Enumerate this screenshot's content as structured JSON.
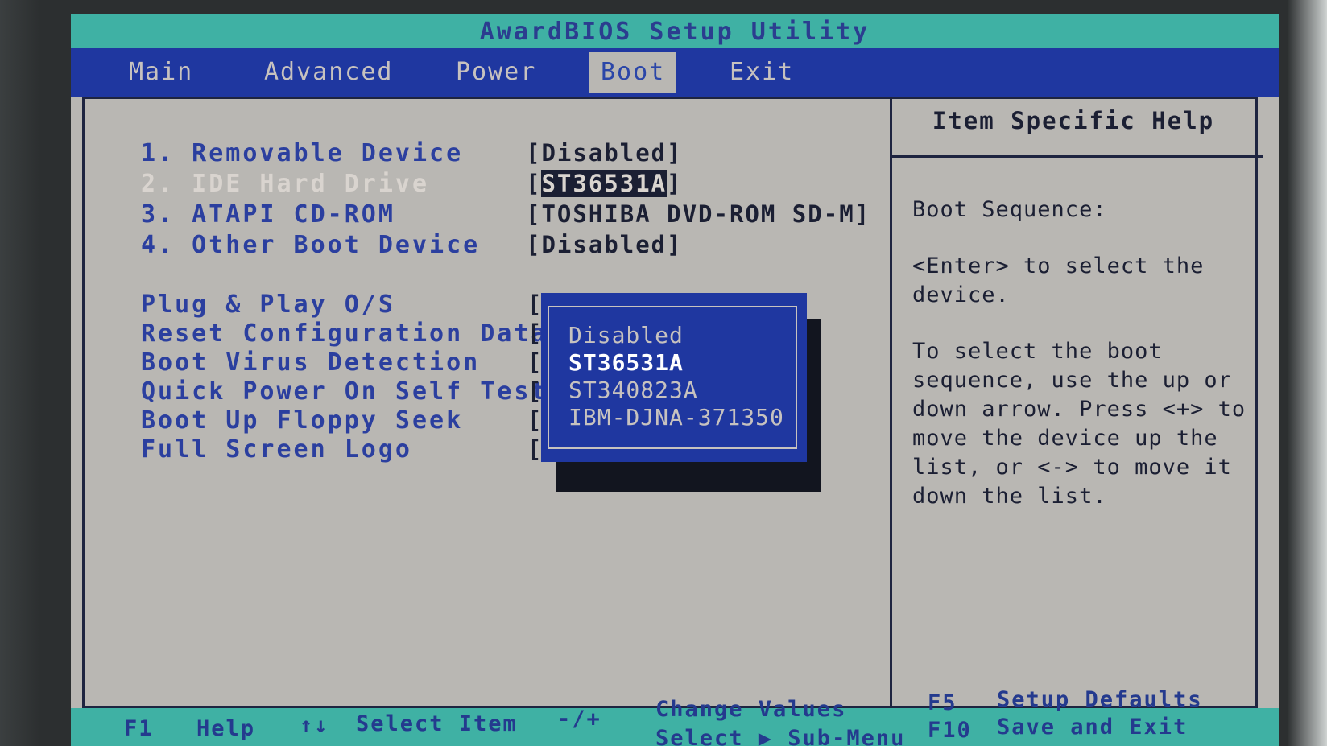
{
  "title": "AwardBIOS Setup Utility",
  "menu": {
    "tabs": [
      "Main",
      "Advanced",
      "Power",
      "Boot",
      "Exit"
    ],
    "active": "Boot"
  },
  "boot_items": [
    {
      "label": "1. Removable Device",
      "value": "[Disabled]"
    },
    {
      "label": "2. IDE Hard Drive",
      "value_prefix": "[",
      "value_highlight": "ST36531A",
      "value_suffix": "]"
    },
    {
      "label": "3. ATAPI CD-ROM",
      "value": "[TOSHIBA DVD-ROM SD-M]"
    },
    {
      "label": "4. Other Boot Device",
      "value": "[Disabled]"
    }
  ],
  "options": [
    {
      "label": "Plug & Play O/S"
    },
    {
      "label": "Reset Configuration Data"
    },
    {
      "label": "Boot Virus Detection"
    },
    {
      "label": "Quick Power On Self Test"
    },
    {
      "label": "Boot Up Floppy Seek"
    },
    {
      "label": "Full Screen Logo"
    }
  ],
  "bracket_char": "[",
  "popup": {
    "options": [
      "Disabled",
      "ST36531A",
      "ST340823A",
      "IBM-DJNA-371350"
    ],
    "current": "ST36531A"
  },
  "help": {
    "title": "Item Specific Help",
    "heading": "Boot Sequence:",
    "para1": "<Enter> to select the device.",
    "para2": "To select the boot sequence, use the up or down arrow. Press <+> to move the device up the list, or <-> to move it down the list."
  },
  "footer": {
    "f1_key": "F1",
    "f1_label": "Help",
    "arrows_key": "↑↓",
    "arrows_label": "Select Item",
    "pm_key": "-/+",
    "pm_label": "Change Values",
    "enter_label": "Select ▶ Sub-Menu",
    "f5_key": "F5",
    "f5_label": "Setup Defaults",
    "f10_key": "F10",
    "f10_label": "Save and Exit"
  }
}
